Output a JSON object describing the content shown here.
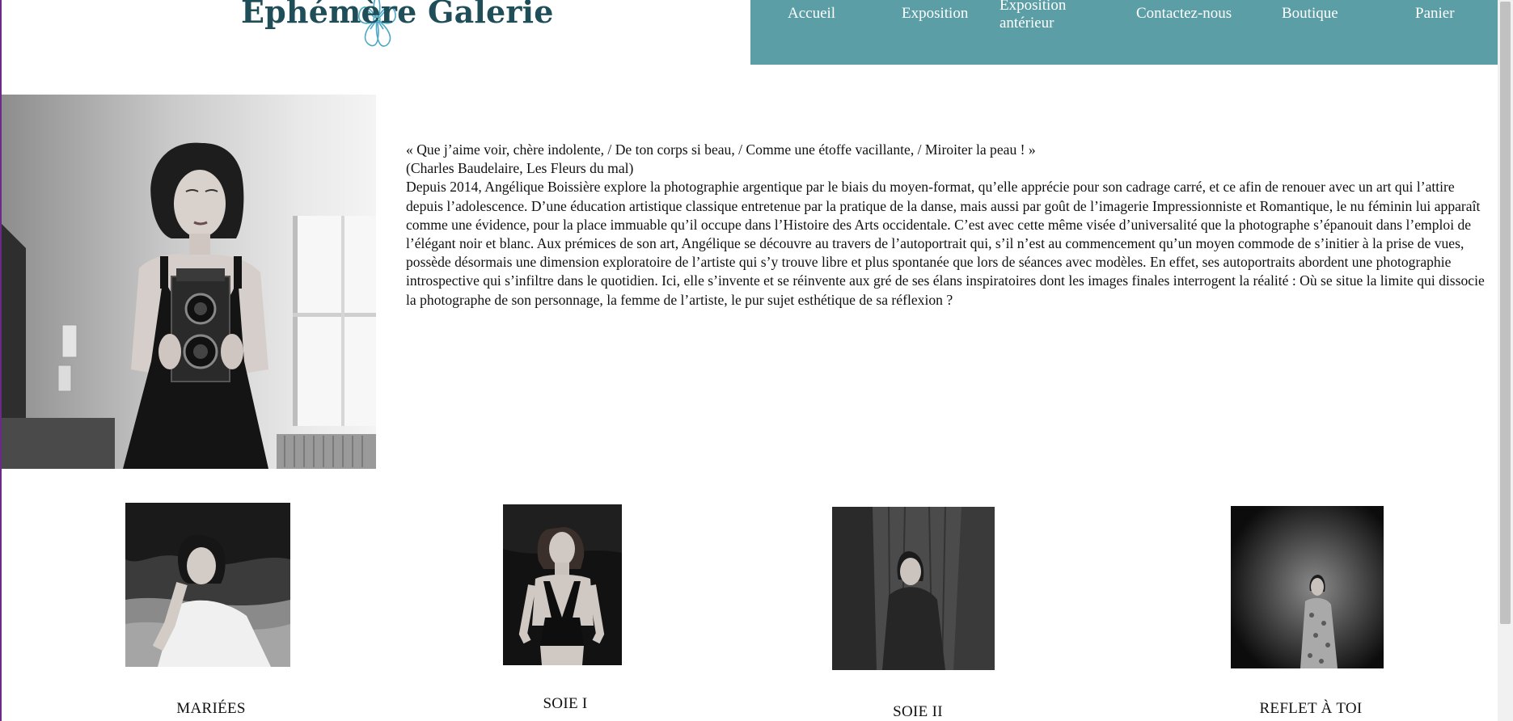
{
  "header": {
    "logo_text": "Ephémère Galerie"
  },
  "nav": {
    "items": [
      {
        "label": "Accueil"
      },
      {
        "label": "Exposition"
      },
      {
        "label_line1": "Exposition",
        "label_line2": "antérieur"
      },
      {
        "label": "Contactez-nous"
      },
      {
        "label": "Boutique"
      },
      {
        "label": "Panier"
      }
    ]
  },
  "intro": {
    "quote": "« Que j’aime voir, chère indolente, / De ton corps si beau, / Comme une étoffe vacillante, / Miroiter la peau ! »",
    "attribution": "(Charles Baudelaire, Les Fleurs du mal)",
    "body": "Depuis 2014, Angélique Boissière explore la photographie argentique par le biais du moyen-format, qu’elle apprécie pour son cadrage carré, et ce afin de renouer avec un art qui l’attire depuis l’adolescence. D’une éducation artistique classique entretenue par la pratique de la danse, mais aussi par goût de l’imagerie Impressionniste et Romantique, le nu féminin lui apparaît comme une évidence, pour la place immuable qu’il occupe dans l’Histoire des Arts occidentale. C’est avec cette même visée d’universalité que la photographe s’épanouit dans l’emploi de l’élégant noir et blanc. Aux prémices de son art, Angélique se découvre au travers de l’autoportrait qui, s’il n’est au commencement qu’un moyen commode de s’initier à la prise de vues, possède désormais une dimension exploratoire de l’artiste qui s’y trouve libre et plus spontanée que lors de séances avec modèles. En effet, ses autoportraits abordent une photographie introspective qui s’infiltre dans le quotidien. Ici, elle s’invente et se réinvente aux gré de ses élans inspiratoires dont les images finales interrogent la réalité : Où se situe la limite qui dissocie la photographe de son personnage, la femme de l’artiste, le pur sujet esthétique de sa réflexion ?"
  },
  "gallery": [
    {
      "title": "MARIÉES"
    },
    {
      "title": "SOIE I"
    },
    {
      "title": "SOIE II"
    },
    {
      "title": "REFLET À TOI"
    }
  ],
  "colors": {
    "nav_bg": "#5b9ea6",
    "logo_text": "#1f4e58",
    "logo_flower": "#4aa8c4"
  }
}
